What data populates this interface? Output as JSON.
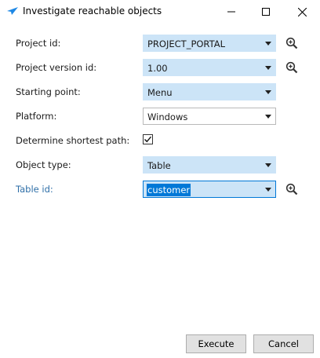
{
  "window": {
    "title": "Investigate reachable objects",
    "icons": {
      "app": "paper-plane-icon",
      "minimize": "minimize-icon",
      "maximize": "maximize-icon",
      "close": "close-icon"
    }
  },
  "form": {
    "project_id": {
      "label": "Project id:",
      "value": "PROJECT_PORTAL",
      "icon": "zoom-in-icon"
    },
    "project_version_id": {
      "label": "Project version id:",
      "value": "1.00",
      "icon": "zoom-in-icon"
    },
    "starting_point": {
      "label": "Starting point:",
      "value": "Menu"
    },
    "platform": {
      "label": "Platform:",
      "value": "Windows"
    },
    "shortest_path": {
      "label": "Determine shortest path:",
      "checked": true
    },
    "object_type": {
      "label": "Object type:",
      "value": "Table"
    },
    "table_id": {
      "label": "Table id:",
      "value": "customer",
      "icon": "zoom-in-icon"
    }
  },
  "buttons": {
    "execute": "Execute",
    "cancel": "Cancel"
  },
  "colors": {
    "highlight": "#cce4f7",
    "focus_border": "#0078d7",
    "link_label": "#2f6fa8",
    "button_bg": "#e1e1e1"
  }
}
